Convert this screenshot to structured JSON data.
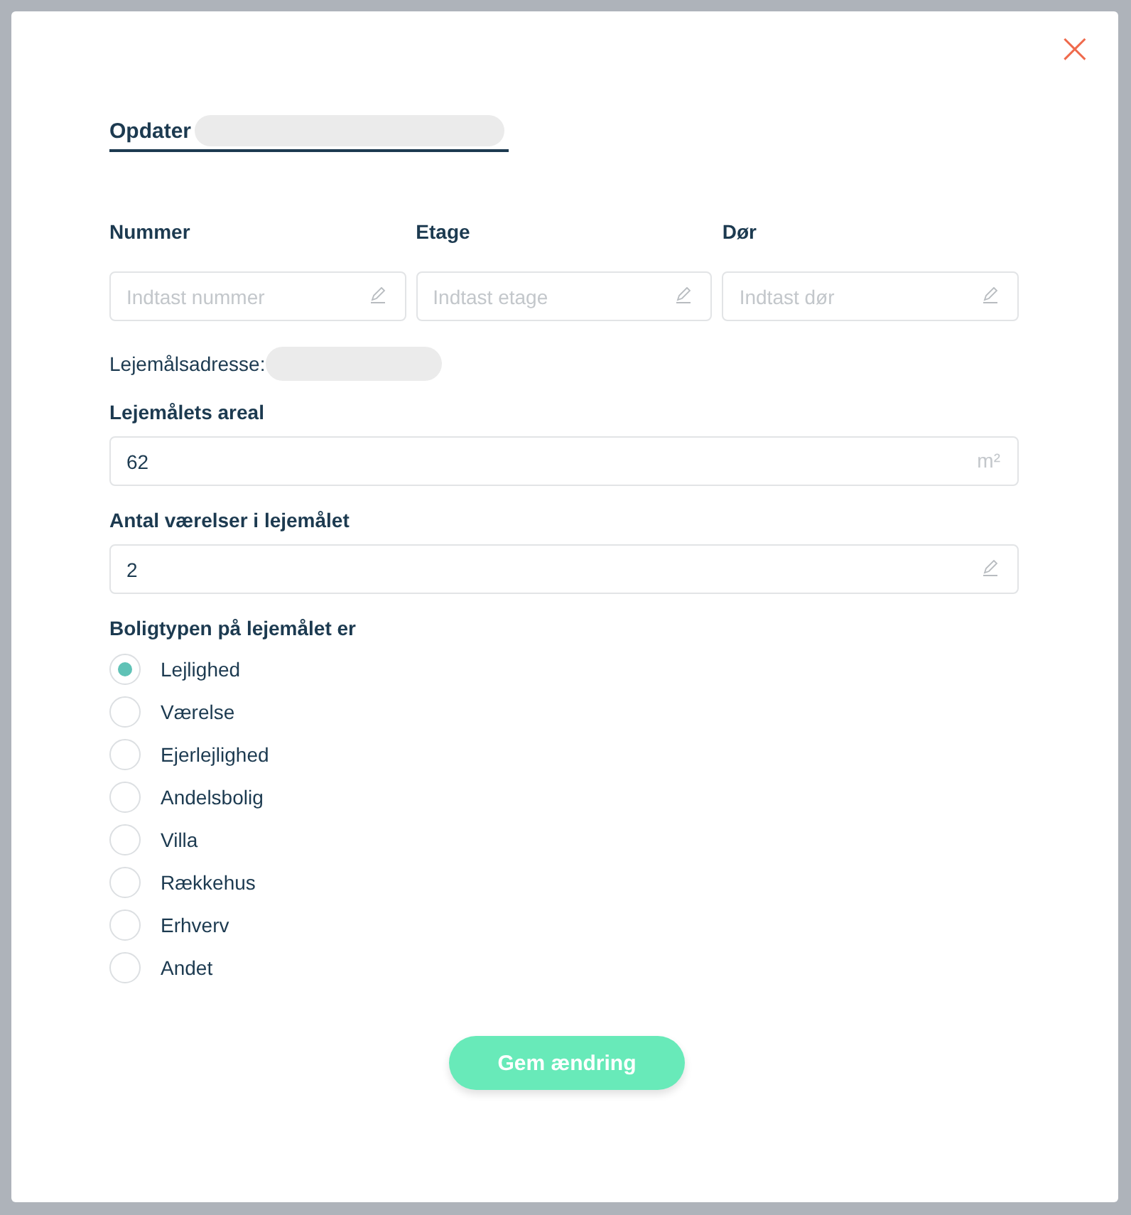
{
  "dialog": {
    "title": "Opdater",
    "close": "×"
  },
  "row_fields": [
    {
      "label": "Nummer",
      "placeholder": "Indtast nummer",
      "kind": "editable"
    },
    {
      "label": "Etage",
      "placeholder": "Indtast etage",
      "kind": "editable"
    },
    {
      "label": "Dør",
      "placeholder": "Indtast dør",
      "kind": "editable"
    }
  ],
  "address_label": "Lejemålsadresse:",
  "fields": [
    {
      "label": "Lejemålets areal",
      "value": "62",
      "kind": "measure",
      "unit": "m²"
    },
    {
      "label": "Antal værelser i lejemålet",
      "value": "2",
      "kind": "editable"
    }
  ],
  "housing_type": {
    "label": "Boligtypen på lejemålet er",
    "options": [
      {
        "label": "Lejlighed",
        "selected": true
      },
      {
        "label": "Værelse",
        "selected": false
      },
      {
        "label": "Ejerlejlighed",
        "selected": false
      },
      {
        "label": "Andelsbolig",
        "selected": false
      },
      {
        "label": "Villa",
        "selected": false
      },
      {
        "label": "Rækkehus",
        "selected": false
      },
      {
        "label": "Erhverv",
        "selected": false
      },
      {
        "label": "Andet",
        "selected": false
      }
    ]
  },
  "save_button": "Gem ændring"
}
